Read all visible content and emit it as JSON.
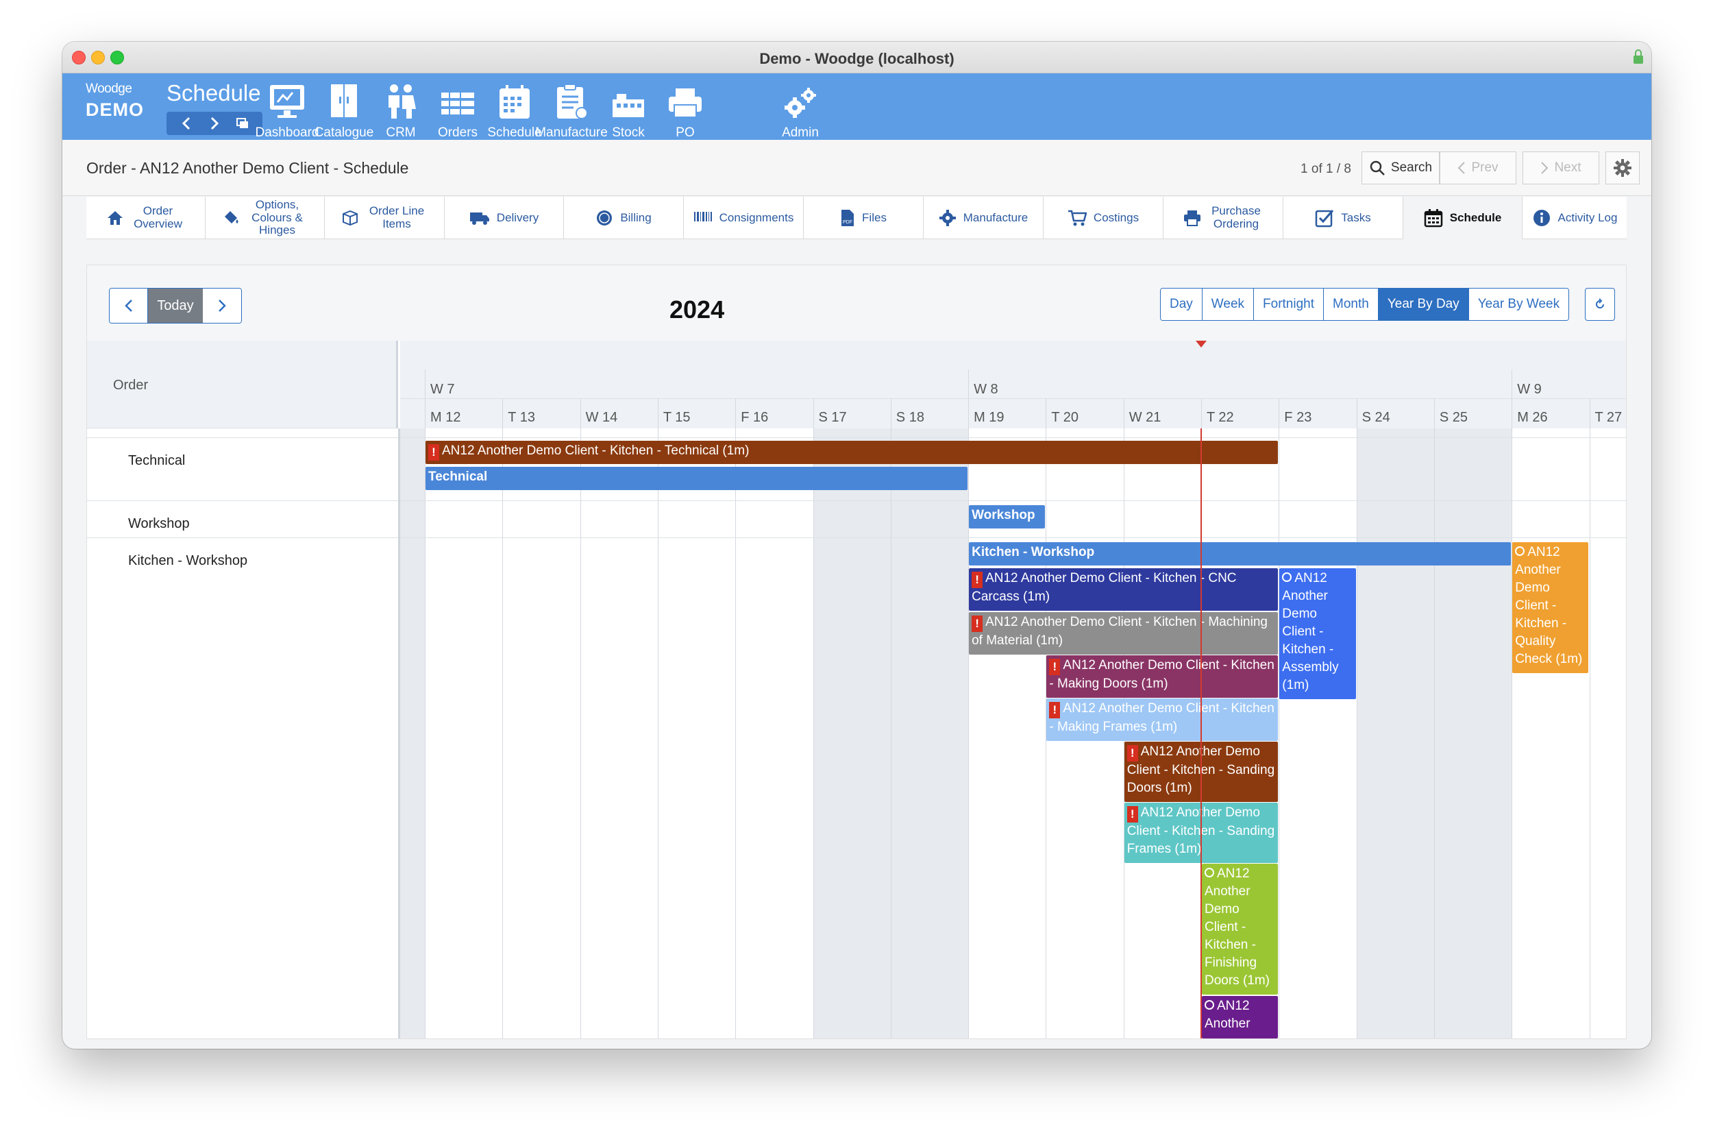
{
  "window": {
    "title": "Demo - Woodge (localhost)"
  },
  "brand": {
    "top": "Woodge",
    "bottom": "DEMO"
  },
  "header": {
    "section_title": "Schedule",
    "nav": [
      {
        "label": "Dashboard",
        "icon": "monitor-icon"
      },
      {
        "label": "Catalogue",
        "icon": "cabinet-icon"
      },
      {
        "label": "CRM",
        "icon": "people-icon"
      },
      {
        "label": "Orders",
        "icon": "orders-icon"
      },
      {
        "label": "Schedule",
        "icon": "calendar-icon"
      },
      {
        "label": "Manufacture",
        "icon": "clipboard-icon"
      },
      {
        "label": "Stock",
        "icon": "stock-icon"
      },
      {
        "label": "PO",
        "icon": "po-icon"
      },
      {
        "label": "Admin",
        "icon": "gears-icon"
      }
    ]
  },
  "subheader": {
    "title": "Order - AN12 Another Demo Client - Schedule",
    "record_count": "1 of 1 / 8",
    "search_label": "Search",
    "prev_label": "Prev",
    "next_label": "Next"
  },
  "tabs": [
    {
      "label": "Order Overview",
      "icon": "home-icon"
    },
    {
      "label": "Options, Colours & Hinges",
      "icon": "paint-bucket-icon"
    },
    {
      "label": "Order Line Items",
      "icon": "box-icon"
    },
    {
      "label": "Delivery",
      "icon": "truck-icon"
    },
    {
      "label": "Billing",
      "icon": "coin-icon"
    },
    {
      "label": "Consignments",
      "icon": "barcode-icon"
    },
    {
      "label": "Files",
      "icon": "pdf-icon"
    },
    {
      "label": "Manufacture",
      "icon": "gear-icon"
    },
    {
      "label": "Costings",
      "icon": "cart-icon"
    },
    {
      "label": "Purchase Ordering",
      "icon": "printer-icon"
    },
    {
      "label": "Tasks",
      "icon": "checkbox-icon"
    },
    {
      "label": "Schedule",
      "icon": "calendar-icon",
      "active": true
    },
    {
      "label": "Activity Log",
      "icon": "info-icon"
    }
  ],
  "calendar": {
    "today_label": "Today",
    "year": "2024",
    "views": [
      "Day",
      "Week",
      "Fortnight",
      "Month",
      "Year By Day",
      "Year By Week"
    ],
    "active_view": "Year By Day",
    "resource_header": "Order",
    "weeks": [
      "W 7",
      "W 8",
      "W 9"
    ],
    "days": [
      "M 12",
      "T 13",
      "W 14",
      "T 15",
      "F 16",
      "S 17",
      "S 18",
      "M 19",
      "T 20",
      "W 21",
      "T 22",
      "F 23",
      "S 24",
      "S 25",
      "M 26",
      "T 27"
    ],
    "resources": [
      "Technical",
      "Workshop",
      "Kitchen - Workshop"
    ],
    "events": [
      {
        "text": "AN12 Another Demo Client - Kitchen - Technical (1m)",
        "color": "#8b3a0f",
        "status": "alert"
      },
      {
        "text": "Technical",
        "color": "#4a86d8",
        "status": "group"
      },
      {
        "text": "Workshop",
        "color": "#4a86d8",
        "status": "group"
      },
      {
        "text": "Kitchen - Workshop",
        "color": "#4a86d8",
        "status": "group"
      },
      {
        "text": "AN12 Another Demo Client - Kitchen - CNC Carcass (1m)",
        "color": "#2e3a9e",
        "status": "alert"
      },
      {
        "text": "AN12 Another Demo Client - Kitchen - Assembly (1m)",
        "color": "#3d6ef0",
        "status": "open"
      },
      {
        "text": "AN12 Another Demo Client - Kitchen - Quality Check (1m)",
        "color": "#f0a030",
        "status": "open"
      },
      {
        "text": "AN12 Another Demo Client - Kitchen - Machining of Material (1m)",
        "color": "#8e8e8e",
        "status": "alert"
      },
      {
        "text": "AN12 Another Demo Client - Kitchen - Making Doors (1m)",
        "color": "#8a3465",
        "status": "alert"
      },
      {
        "text": "AN12 Another Demo Client - Kitchen - Making Frames (1m)",
        "color": "#9ec7f5",
        "status": "alert"
      },
      {
        "text": "AN12 Another Demo Client - Kitchen - Sanding Doors (1m)",
        "color": "#8b3a0f",
        "status": "alert"
      },
      {
        "text": "AN12 Another Demo Client - Kitchen - Sanding Frames (1m)",
        "color": "#5fc6c6",
        "status": "alert"
      },
      {
        "text": "AN12 Another Demo Client - Kitchen - Finishing Doors (1m)",
        "color": "#9bc634",
        "status": "open"
      },
      {
        "text": "AN12 Another",
        "color": "#6a1d8c",
        "status": "open"
      }
    ]
  }
}
